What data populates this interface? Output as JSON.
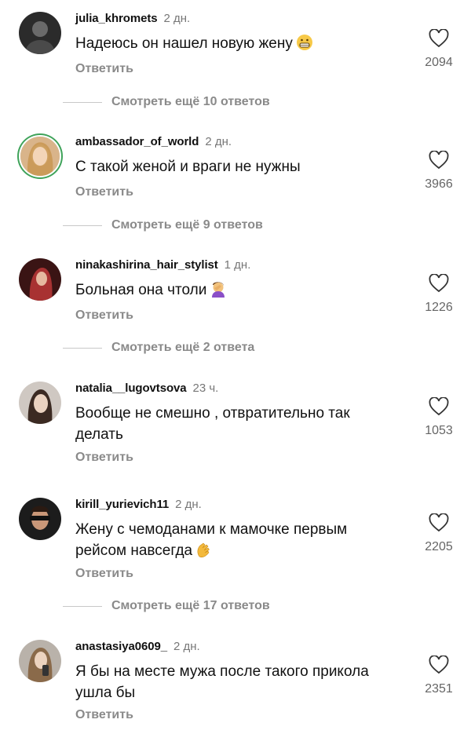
{
  "colors": {
    "text": "#111111",
    "muted": "#8a8a8a",
    "time": "#777777",
    "story_ring": "#3fa35a"
  },
  "comments": [
    {
      "username": "julia_khromets",
      "time": "2 дн.",
      "text": "Надеюсь он нашел новую жену",
      "emoji": "grinning-face-icon",
      "reply_label": "Ответить",
      "likes": "2094",
      "more_replies": "Смотреть ещё 10 ответов"
    },
    {
      "username": "ambassador_of_world",
      "time": "2 дн.",
      "text": "С такой женой и враги не нужны",
      "reply_label": "Ответить",
      "likes": "3966",
      "more_replies": "Смотреть ещё 9 ответов"
    },
    {
      "username": "ninakashirina_hair_stylist",
      "time": "1 дн.",
      "text": "Больная она чтоли",
      "emoji": "facepalm-icon",
      "reply_label": "Ответить",
      "likes": "1226",
      "more_replies": "Смотреть ещё 2 ответа"
    },
    {
      "username": "natalia__lugovtsova",
      "time": "23 ч.",
      "text": "Вообще не смешно , отвратительно так делать",
      "reply_label": "Ответить",
      "likes": "1053"
    },
    {
      "username": "kirill_yurievich11",
      "time": "2 дн.",
      "text": "Жену с чемоданами к мамочке первым рейсом навсегда",
      "emoji": "clapping-hands-icon",
      "reply_label": "Ответить",
      "likes": "2205",
      "more_replies": "Смотреть ещё 17 ответов"
    },
    {
      "username": "anastasiya0609_",
      "time": "2 дн.",
      "text": "Я бы на месте мужа после такого прикола ушла бы",
      "reply_label": "Ответить",
      "likes": "2351"
    }
  ]
}
